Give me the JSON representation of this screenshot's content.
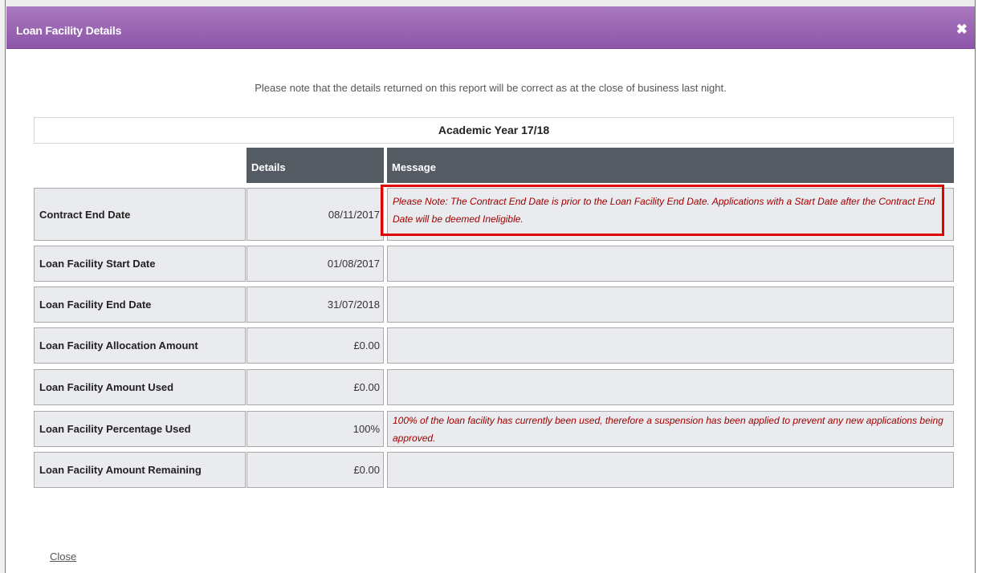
{
  "dialog": {
    "title": "Loan Facility Details",
    "close_icon": "close-icon"
  },
  "note": "Please note that the details returned on this report will be correct as at the close of business last night.",
  "academic_year": "Academic Year 17/18",
  "table": {
    "headers": {
      "details": "Details",
      "message": "Message"
    },
    "rows": [
      {
        "label": "Contract End Date",
        "value": "08/11/2017",
        "message": "Please Note: The Contract End Date is prior to the Loan Facility End Date. Applications with a Start Date after the Contract End Date will be deemed Ineligible."
      },
      {
        "label": "Loan Facility Start Date",
        "value": "01/08/2017",
        "message": ""
      },
      {
        "label": "Loan Facility End Date",
        "value": "31/07/2018",
        "message": ""
      },
      {
        "label": "Loan Facility Allocation Amount",
        "value": "£0.00",
        "message": ""
      },
      {
        "label": "Loan Facility Amount Used",
        "value": "£0.00",
        "message": ""
      },
      {
        "label": "Loan Facility Percentage Used",
        "value": "100%",
        "message": "100% of the loan facility has currently been used, therefore a suspension has been applied to prevent any new applications being approved."
      },
      {
        "label": "Loan Facility Amount Remaining",
        "value": "£0.00",
        "message": ""
      }
    ]
  },
  "close_link": "Close",
  "colors": {
    "titlebar": "#9a63b3",
    "header": "#555b63",
    "cell_bg": "#e9ebee",
    "message_text": "#a00000",
    "highlight": "#e00000"
  }
}
